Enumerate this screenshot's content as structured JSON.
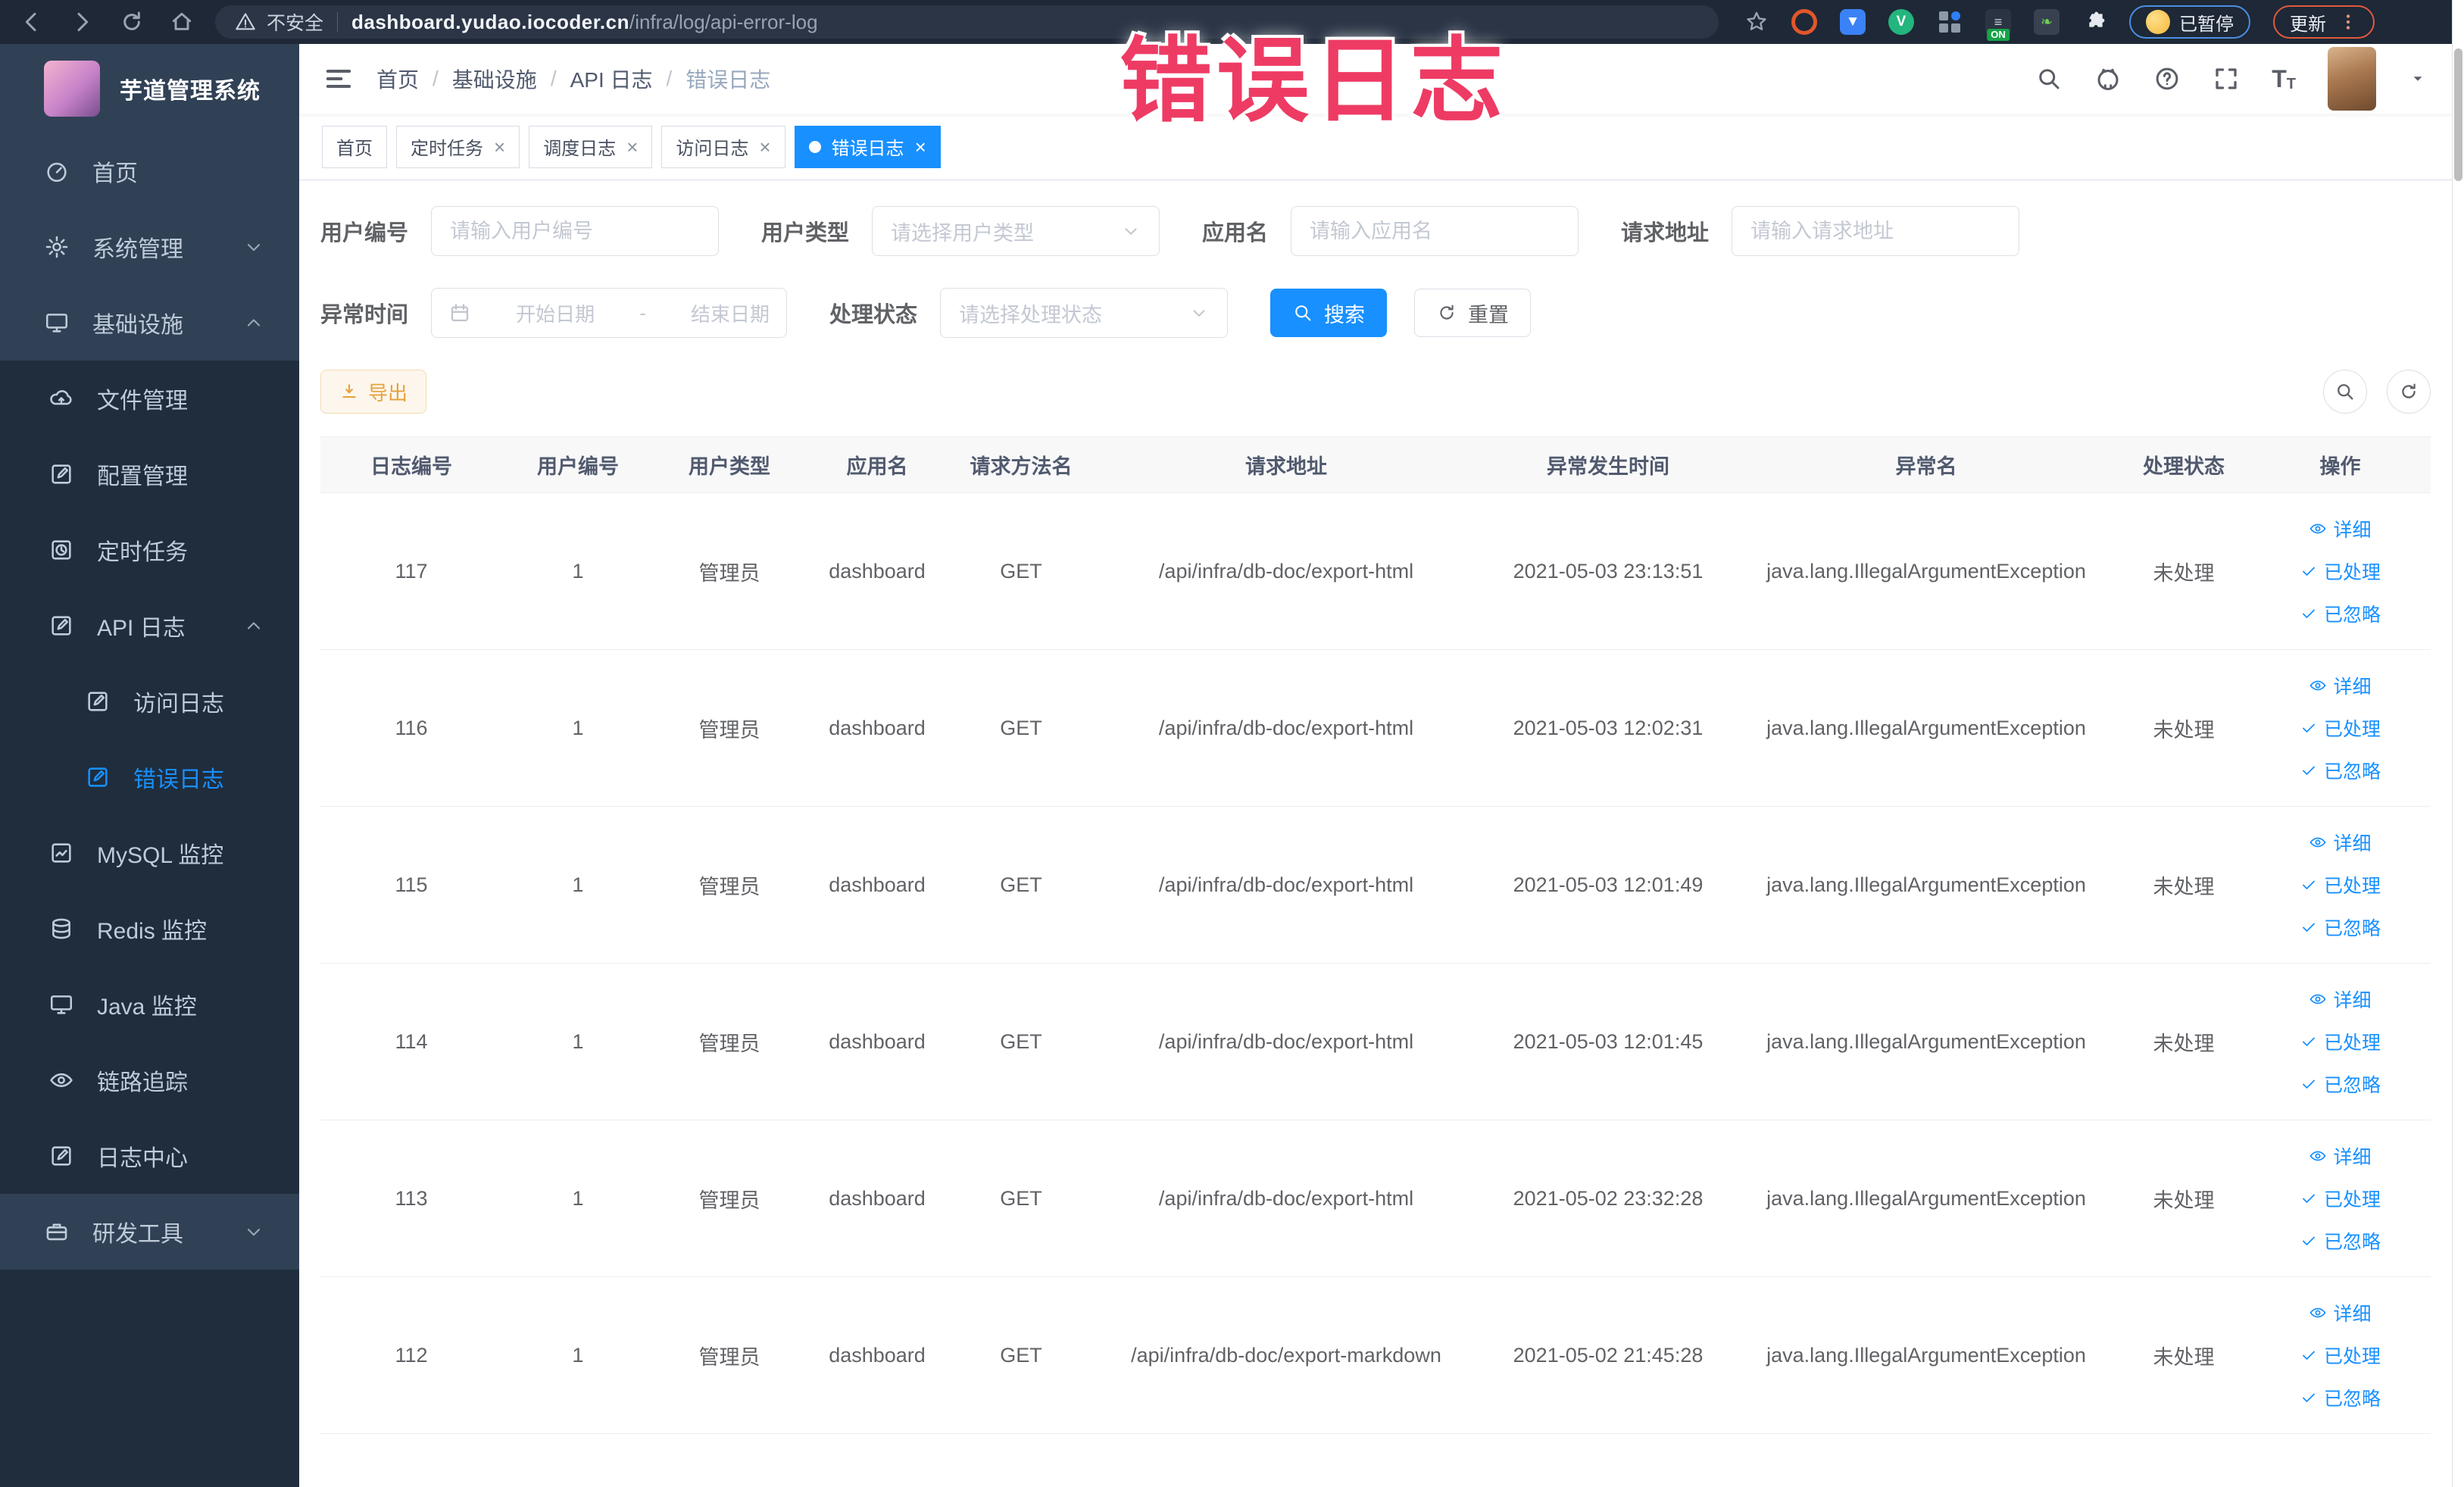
{
  "annotation": {
    "text": "错误日志",
    "color": "#ee3b64"
  },
  "browser": {
    "security_label": "不安全",
    "url_host": "dashboard.yudao.iocoder.cn",
    "url_path": "/infra/log/api-error-log",
    "paused_label": "已暂停",
    "update_label": "更新"
  },
  "sidebar": {
    "app_title": "芋道管理系统",
    "menu": [
      {
        "label": "首页",
        "icon": "dashboard",
        "level": 1
      },
      {
        "label": "系统管理",
        "icon": "gear",
        "level": 1,
        "chevron": "down"
      },
      {
        "label": "基础设施",
        "icon": "monitor",
        "level": 1,
        "chevron": "up"
      },
      {
        "label": "文件管理",
        "icon": "cloud-up",
        "level": 2,
        "sub": true
      },
      {
        "label": "配置管理",
        "icon": "edit-square",
        "level": 2,
        "sub": true
      },
      {
        "label": "定时任务",
        "icon": "timer",
        "level": 2,
        "sub": true
      },
      {
        "label": "API 日志",
        "icon": "edit-square",
        "level": 2,
        "sub": true,
        "chevron": "up"
      },
      {
        "label": "访问日志",
        "icon": "edit-square",
        "level": 3,
        "sub": true
      },
      {
        "label": "错误日志",
        "icon": "edit-square",
        "level": 3,
        "sub": true,
        "active": true
      },
      {
        "label": "MySQL 监控",
        "icon": "chart",
        "level": 2,
        "sub": true
      },
      {
        "label": "Redis 监控",
        "icon": "database",
        "level": 2,
        "sub": true
      },
      {
        "label": "Java 监控",
        "icon": "monitor",
        "level": 2,
        "sub": true
      },
      {
        "label": "链路追踪",
        "icon": "eye",
        "level": 2,
        "sub": true
      },
      {
        "label": "日志中心",
        "icon": "edit-square",
        "level": 2,
        "sub": true
      },
      {
        "label": "研发工具",
        "icon": "toolbox",
        "level": 1,
        "chevron": "down"
      }
    ]
  },
  "header": {
    "breadcrumbs": [
      "首页",
      "基础设施",
      "API 日志",
      "错误日志"
    ]
  },
  "tabs": [
    {
      "label": "首页",
      "closable": false,
      "active": false
    },
    {
      "label": "定时任务",
      "closable": true,
      "active": false
    },
    {
      "label": "调度日志",
      "closable": true,
      "active": false
    },
    {
      "label": "访问日志",
      "closable": true,
      "active": false
    },
    {
      "label": "错误日志",
      "closable": true,
      "active": true
    }
  ],
  "filters": {
    "row1": [
      {
        "label": "用户编号",
        "type": "input",
        "placeholder": "请输入用户编号"
      },
      {
        "label": "用户类型",
        "type": "select",
        "placeholder": "请选择用户类型"
      },
      {
        "label": "应用名",
        "type": "input",
        "placeholder": "请输入应用名"
      },
      {
        "label": "请求地址",
        "type": "input",
        "placeholder": "请输入请求地址"
      }
    ],
    "row2": [
      {
        "label": "异常时间",
        "type": "daterange",
        "start_placeholder": "开始日期",
        "separator": "-",
        "end_placeholder": "结束日期"
      },
      {
        "label": "处理状态",
        "type": "select",
        "placeholder": "请选择处理状态"
      }
    ],
    "search_label": "搜索",
    "reset_label": "重置"
  },
  "toolbar": {
    "export_label": "导出"
  },
  "table": {
    "columns": [
      "日志编号",
      "用户编号",
      "用户类型",
      "应用名",
      "请求方法名",
      "请求地址",
      "异常发生时间",
      "异常名",
      "处理状态",
      "操作"
    ],
    "action_labels": {
      "detail": "详细",
      "processed": "已处理",
      "ignored": "已忽略"
    },
    "rows": [
      {
        "log_id": "117",
        "user_id": "1",
        "user_type": "管理员",
        "app": "dashboard",
        "method": "GET",
        "url": "/api/infra/db-doc/export-html",
        "time": "2021-05-03 23:13:51",
        "exception": "java.lang.IllegalArgumentException",
        "status": "未处理"
      },
      {
        "log_id": "116",
        "user_id": "1",
        "user_type": "管理员",
        "app": "dashboard",
        "method": "GET",
        "url": "/api/infra/db-doc/export-html",
        "time": "2021-05-03 12:02:31",
        "exception": "java.lang.IllegalArgumentException",
        "status": "未处理"
      },
      {
        "log_id": "115",
        "user_id": "1",
        "user_type": "管理员",
        "app": "dashboard",
        "method": "GET",
        "url": "/api/infra/db-doc/export-html",
        "time": "2021-05-03 12:01:49",
        "exception": "java.lang.IllegalArgumentException",
        "status": "未处理"
      },
      {
        "log_id": "114",
        "user_id": "1",
        "user_type": "管理员",
        "app": "dashboard",
        "method": "GET",
        "url": "/api/infra/db-doc/export-html",
        "time": "2021-05-03 12:01:45",
        "exception": "java.lang.IllegalArgumentException",
        "status": "未处理"
      },
      {
        "log_id": "113",
        "user_id": "1",
        "user_type": "管理员",
        "app": "dashboard",
        "method": "GET",
        "url": "/api/infra/db-doc/export-html",
        "time": "2021-05-02 23:32:28",
        "exception": "java.lang.IllegalArgumentException",
        "status": "未处理"
      },
      {
        "log_id": "112",
        "user_id": "1",
        "user_type": "管理员",
        "app": "dashboard",
        "method": "GET",
        "url": "/api/infra/db-doc/export-markdown",
        "time": "2021-05-02 21:45:28",
        "exception": "java.lang.IllegalArgumentException",
        "status": "未处理"
      }
    ]
  },
  "colors": {
    "accent": "#1890ff",
    "warning": "#e6a23c",
    "sidebar_bg": "#304156",
    "submenu_bg": "#1f2d3d"
  }
}
